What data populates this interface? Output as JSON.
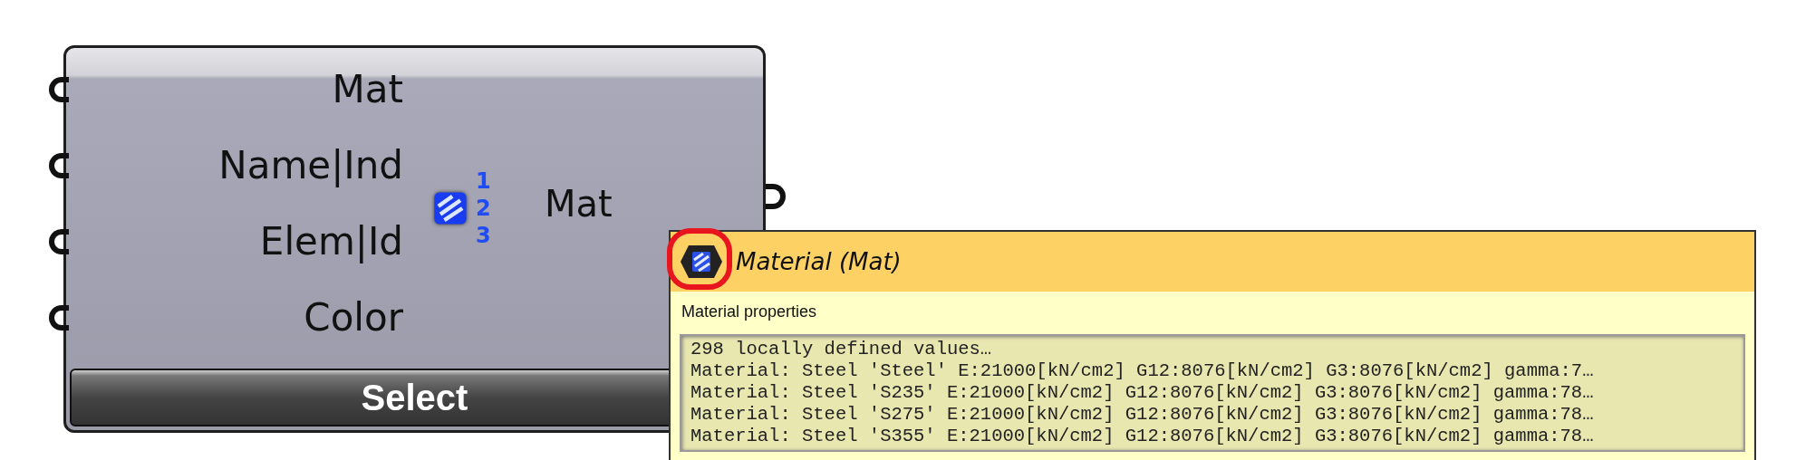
{
  "component": {
    "inputs": [
      {
        "label": "Mat"
      },
      {
        "label": "Name|Ind"
      },
      {
        "label": "Elem|Id"
      },
      {
        "label": "Color"
      }
    ],
    "list_access_numbers": [
      "1",
      "2",
      "3"
    ],
    "output": {
      "label": "Mat"
    },
    "button": "Select"
  },
  "tooltip": {
    "title": "Material (Mat)",
    "description": "Material properties",
    "values": [
      "298 locally defined values…",
      "Material: Steel 'Steel' E:21000[kN/cm2] G12:8076[kN/cm2] G3:8076[kN/cm2] gamma:7…",
      "Material: Steel 'S235' E:21000[kN/cm2] G12:8076[kN/cm2] G3:8076[kN/cm2] gamma:78…",
      "Material: Steel 'S275' E:21000[kN/cm2] G12:8076[kN/cm2] G3:8076[kN/cm2] gamma:78…",
      "Material: Steel 'S355' E:21000[kN/cm2] G12:8076[kN/cm2] G3:8076[kN/cm2] gamma:78…"
    ]
  }
}
